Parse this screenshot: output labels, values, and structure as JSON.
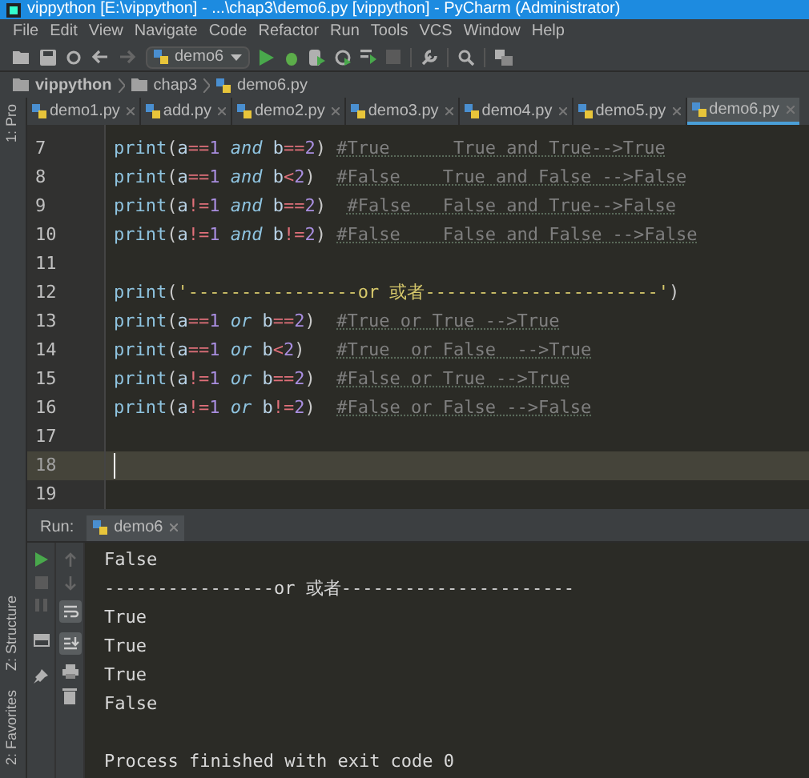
{
  "window": {
    "title": "vippython [E:\\vippython] - ...\\chap3\\demo6.py [vippython] - PyCharm (Administrator)"
  },
  "menu": [
    "File",
    "Edit",
    "View",
    "Navigate",
    "Code",
    "Refactor",
    "Run",
    "Tools",
    "VCS",
    "Window",
    "Help"
  ],
  "toolbar": {
    "run_config": "demo6"
  },
  "breadcrumb": [
    "vippython",
    "chap3",
    "demo6.py"
  ],
  "tabs": [
    {
      "label": "demo1.py",
      "selected": false
    },
    {
      "label": "add.py",
      "selected": false
    },
    {
      "label": "demo2.py",
      "selected": false
    },
    {
      "label": "demo3.py",
      "selected": false
    },
    {
      "label": "demo4.py",
      "selected": false
    },
    {
      "label": "demo5.py",
      "selected": false
    },
    {
      "label": "demo6.py",
      "selected": true
    }
  ],
  "side_stripe": {
    "top": [
      "1: Pro"
    ],
    "bottom": [
      "Z: Structure",
      "2: Favorites"
    ]
  },
  "editor": {
    "lines": [
      {
        "number": "7",
        "current": false,
        "tokens": [
          {
            "kind": "builtin",
            "text": "print"
          },
          {
            "kind": "paren",
            "text": "("
          },
          {
            "kind": "ident",
            "text": "a"
          },
          {
            "kind": "op",
            "text": "=="
          },
          {
            "kind": "number",
            "text": "1"
          },
          {
            "kind": "keyword",
            "text": " and "
          },
          {
            "kind": "ident",
            "text": "b"
          },
          {
            "kind": "op",
            "text": "=="
          },
          {
            "kind": "number",
            "text": "2"
          },
          {
            "kind": "paren",
            "text": ") "
          },
          {
            "kind": "comment",
            "text": "#True      True and True-->True"
          }
        ]
      },
      {
        "number": "8",
        "current": false,
        "tokens": [
          {
            "kind": "builtin",
            "text": "print"
          },
          {
            "kind": "paren",
            "text": "("
          },
          {
            "kind": "ident",
            "text": "a"
          },
          {
            "kind": "op",
            "text": "=="
          },
          {
            "kind": "number",
            "text": "1"
          },
          {
            "kind": "keyword",
            "text": " and "
          },
          {
            "kind": "ident",
            "text": "b"
          },
          {
            "kind": "op",
            "text": "<"
          },
          {
            "kind": "number",
            "text": "2"
          },
          {
            "kind": "paren",
            "text": ")  "
          },
          {
            "kind": "comment",
            "text": "#False    True and False -->False"
          }
        ]
      },
      {
        "number": "9",
        "current": false,
        "tokens": [
          {
            "kind": "builtin",
            "text": "print"
          },
          {
            "kind": "paren",
            "text": "("
          },
          {
            "kind": "ident",
            "text": "a"
          },
          {
            "kind": "op",
            "text": "!="
          },
          {
            "kind": "number",
            "text": "1"
          },
          {
            "kind": "keyword",
            "text": " and "
          },
          {
            "kind": "ident",
            "text": "b"
          },
          {
            "kind": "op",
            "text": "=="
          },
          {
            "kind": "number",
            "text": "2"
          },
          {
            "kind": "paren",
            "text": ")  "
          },
          {
            "kind": "comment",
            "text": "#False   False and True-->False"
          }
        ]
      },
      {
        "number": "10",
        "current": false,
        "tokens": [
          {
            "kind": "builtin",
            "text": "print"
          },
          {
            "kind": "paren",
            "text": "("
          },
          {
            "kind": "ident",
            "text": "a"
          },
          {
            "kind": "op",
            "text": "!="
          },
          {
            "kind": "number",
            "text": "1"
          },
          {
            "kind": "keyword",
            "text": " and "
          },
          {
            "kind": "ident",
            "text": "b"
          },
          {
            "kind": "op",
            "text": "!="
          },
          {
            "kind": "number",
            "text": "2"
          },
          {
            "kind": "paren",
            "text": ") "
          },
          {
            "kind": "comment",
            "text": "#False    False and False -->False"
          }
        ]
      },
      {
        "number": "11",
        "current": false
      },
      {
        "number": "12",
        "current": false,
        "tokens": [
          {
            "kind": "builtin",
            "text": "print"
          },
          {
            "kind": "paren",
            "text": "("
          },
          {
            "kind": "string",
            "text": "'----------------or 或者----------------------'"
          },
          {
            "kind": "paren",
            "text": ")"
          }
        ]
      },
      {
        "number": "13",
        "current": false,
        "tokens": [
          {
            "kind": "builtin",
            "text": "print"
          },
          {
            "kind": "paren",
            "text": "("
          },
          {
            "kind": "ident",
            "text": "a"
          },
          {
            "kind": "op",
            "text": "=="
          },
          {
            "kind": "number",
            "text": "1"
          },
          {
            "kind": "keyword",
            "text": " or "
          },
          {
            "kind": "ident",
            "text": "b"
          },
          {
            "kind": "op",
            "text": "=="
          },
          {
            "kind": "number",
            "text": "2"
          },
          {
            "kind": "paren",
            "text": ")  "
          },
          {
            "kind": "comment",
            "text": "#True or True -->True"
          }
        ]
      },
      {
        "number": "14",
        "current": false,
        "tokens": [
          {
            "kind": "builtin",
            "text": "print"
          },
          {
            "kind": "paren",
            "text": "("
          },
          {
            "kind": "ident",
            "text": "a"
          },
          {
            "kind": "op",
            "text": "=="
          },
          {
            "kind": "number",
            "text": "1"
          },
          {
            "kind": "keyword",
            "text": " or "
          },
          {
            "kind": "ident",
            "text": "b"
          },
          {
            "kind": "op",
            "text": "<"
          },
          {
            "kind": "number",
            "text": "2"
          },
          {
            "kind": "paren",
            "text": ")   "
          },
          {
            "kind": "comment",
            "text": "#True  or False  -->True"
          }
        ]
      },
      {
        "number": "15",
        "current": false,
        "tokens": [
          {
            "kind": "builtin",
            "text": "print"
          },
          {
            "kind": "paren",
            "text": "("
          },
          {
            "kind": "ident",
            "text": "a"
          },
          {
            "kind": "op",
            "text": "!="
          },
          {
            "kind": "number",
            "text": "1"
          },
          {
            "kind": "keyword",
            "text": " or "
          },
          {
            "kind": "ident",
            "text": "b"
          },
          {
            "kind": "op",
            "text": "=="
          },
          {
            "kind": "number",
            "text": "2"
          },
          {
            "kind": "paren",
            "text": ")  "
          },
          {
            "kind": "comment",
            "text": "#False or True -->True"
          }
        ]
      },
      {
        "number": "16",
        "current": false,
        "tokens": [
          {
            "kind": "builtin",
            "text": "print"
          },
          {
            "kind": "paren",
            "text": "("
          },
          {
            "kind": "ident",
            "text": "a"
          },
          {
            "kind": "op",
            "text": "!="
          },
          {
            "kind": "number",
            "text": "1"
          },
          {
            "kind": "keyword",
            "text": " or "
          },
          {
            "kind": "ident",
            "text": "b"
          },
          {
            "kind": "op",
            "text": "!="
          },
          {
            "kind": "number",
            "text": "2"
          },
          {
            "kind": "paren",
            "text": ")  "
          },
          {
            "kind": "comment",
            "text": "#False or False -->False"
          }
        ]
      },
      {
        "number": "17",
        "current": false
      },
      {
        "number": "18",
        "current": true
      },
      {
        "number": "19",
        "current": false
      }
    ]
  },
  "run": {
    "label": "Run:",
    "tab": "demo6",
    "console": [
      {
        "kind": "output",
        "text": "False"
      },
      {
        "kind": "output",
        "text": "----------------or 或者----------------------"
      },
      {
        "kind": "output",
        "text": "True"
      },
      {
        "kind": "output",
        "text": "True"
      },
      {
        "kind": "output",
        "text": "True"
      },
      {
        "kind": "output",
        "text": "False"
      },
      {
        "kind": "blank"
      },
      {
        "kind": "output",
        "text": "Process finished with exit code 0"
      }
    ]
  }
}
